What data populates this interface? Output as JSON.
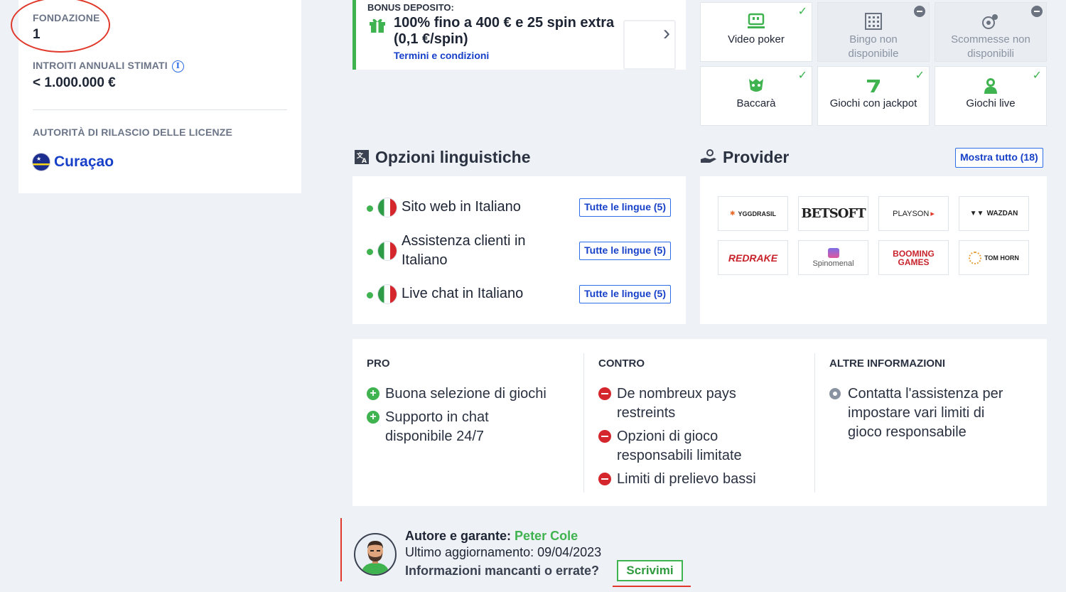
{
  "info": {
    "founded_label": "FONDAZIONE",
    "founded_value": "1",
    "revenue_label": "INTROITI ANNUALI STIMATI",
    "revenue_info_glyph": "i",
    "revenue_value": "< 1.000.000 €",
    "license_label": "AUTORITÀ DI RILASCIO DELLE LICENZE",
    "license_value": "Curaçao"
  },
  "bonus": {
    "label": "BONUS DEPOSITO:",
    "title": "100% fino a 400 € e 25 spin extra (0,1 €/spin)",
    "terms_link": "Termini e condizioni",
    "chevron": "›",
    "accent": "#3fb34f"
  },
  "games": [
    {
      "label": "Video poker",
      "available": true,
      "icon": "video-poker-icon"
    },
    {
      "label": "Bingo non disponibile",
      "available": false,
      "icon": "bingo-icon"
    },
    {
      "label": "Scommesse non disponibili",
      "available": false,
      "icon": "betting-icon"
    },
    {
      "label": "Baccarà",
      "available": true,
      "icon": "baccarat-icon"
    },
    {
      "label": "Giochi con jackpot",
      "available": true,
      "icon": "jackpot-icon"
    },
    {
      "label": "Giochi live",
      "available": true,
      "icon": "live-games-icon"
    }
  ],
  "languages": {
    "title": "Opzioni linguistiche",
    "rows": [
      {
        "text": "Sito web in Italiano",
        "button": "Tutte le lingue (5)"
      },
      {
        "text": "Assistenza clienti in Italiano",
        "button": "Tutte le lingue (5)"
      },
      {
        "text": "Live chat in Italiano",
        "button": "Tutte le lingue (5)"
      }
    ]
  },
  "providers": {
    "title": "Provider",
    "show_all": "Mostra tutto (18)",
    "logos": [
      "YGGDRASIL",
      "BETSOFT",
      "PLAYSON",
      "WAZDAN",
      "REDRAKE",
      "Spinomenal",
      "BOOMING GAMES",
      "TOM HORN"
    ]
  },
  "pros_cons": {
    "pro_header": "PRO",
    "pros": [
      "Buona selezione di giochi",
      "Supporto in chat disponibile 24/7"
    ],
    "con_header": "CONTRO",
    "cons": [
      "De nombreux pays restreints",
      "Opzioni di gioco responsabili limitate",
      "Limiti di prelievo bassi"
    ],
    "other_header": "ALTRE INFORMAZIONI",
    "other": [
      "Contatta l'assistenza per impostare vari limiti di gioco responsabile"
    ]
  },
  "author": {
    "label": "Autore e garante:",
    "name": "Peter Cole",
    "updated": "Ultimo aggiornamento: 09/04/2023",
    "missing_info": "Informazioni mancanti o errate?",
    "write_button": "Scrivimi"
  },
  "colors": {
    "green": "#3fb34f",
    "red": "#d4262c",
    "link_blue": "#1740c9",
    "annotation_red": "#e0392b"
  }
}
